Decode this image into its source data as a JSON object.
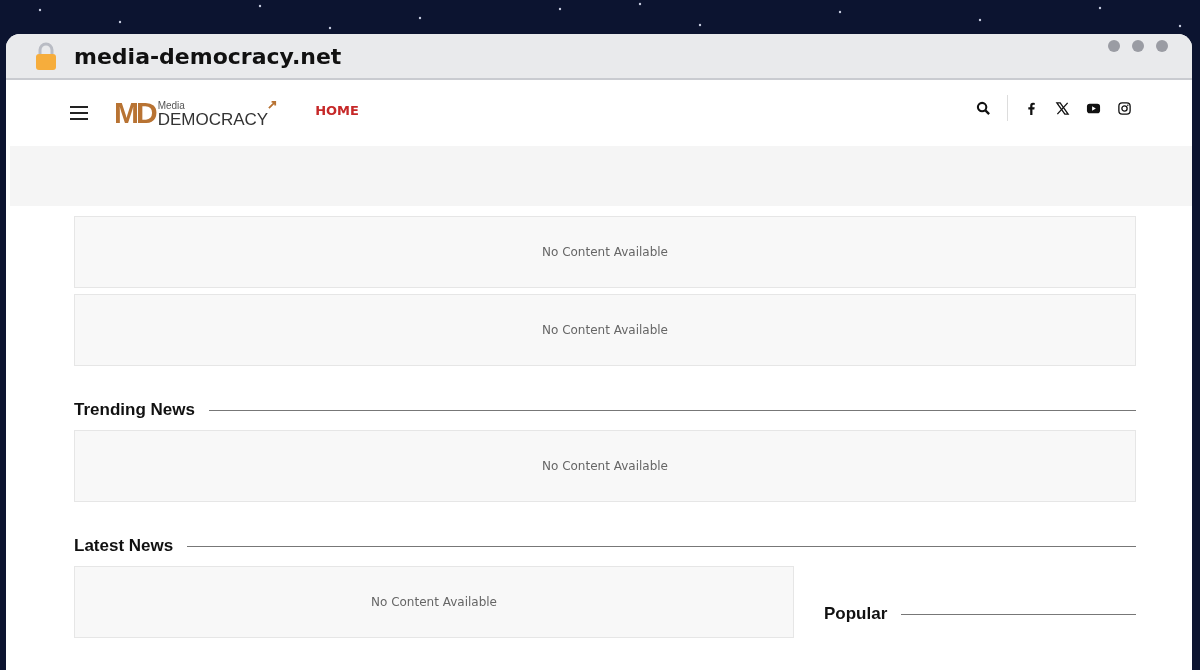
{
  "browser": {
    "url": "media-democracy.net"
  },
  "header": {
    "logo": {
      "mark": "MD",
      "top": "Media",
      "bottom": "DEMOCRACY"
    },
    "nav": [
      {
        "label": "HOME",
        "selected": true
      }
    ]
  },
  "top_blocks": [
    "No Content Available",
    "No Content Available"
  ],
  "sections": [
    {
      "title": "Trending News",
      "blocks": [
        "No Content Available"
      ]
    },
    {
      "title": "Latest News",
      "blocks": [
        "No Content Available"
      ],
      "sidebar_title": "Popular"
    }
  ]
}
